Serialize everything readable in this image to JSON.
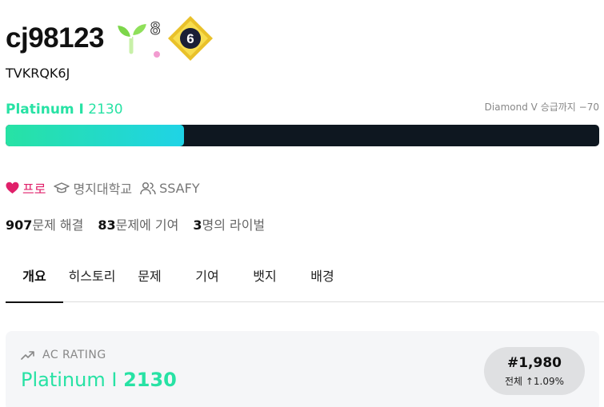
{
  "profile": {
    "username": "cj98123",
    "bio": "TVKRQK6J",
    "sprout_level": "8",
    "class_badge": "6"
  },
  "tier": {
    "name": "Platinum I",
    "rating": "2130",
    "next_text": "Diamond V 승급까지 −70",
    "progress_fraction": 0.3,
    "color": "#27e2a4"
  },
  "tags": {
    "pro": "프로",
    "school": "명지대학교",
    "org": "SSAFY"
  },
  "stats": {
    "solved_count": "907",
    "solved_label": "문제 해결",
    "contrib_count": "83",
    "contrib_label": "문제에 기여",
    "rival_count": "3",
    "rival_label": "명의 라이벌"
  },
  "tabs": [
    "개요",
    "히스토리",
    "문제",
    "기여",
    "뱃지",
    "배경"
  ],
  "rating_card": {
    "title": "AC RATING",
    "tier": "Platinum I",
    "rating": "2130",
    "rank": "#1,980",
    "rank_label": "전체",
    "rank_pct": "↑1.09%"
  }
}
